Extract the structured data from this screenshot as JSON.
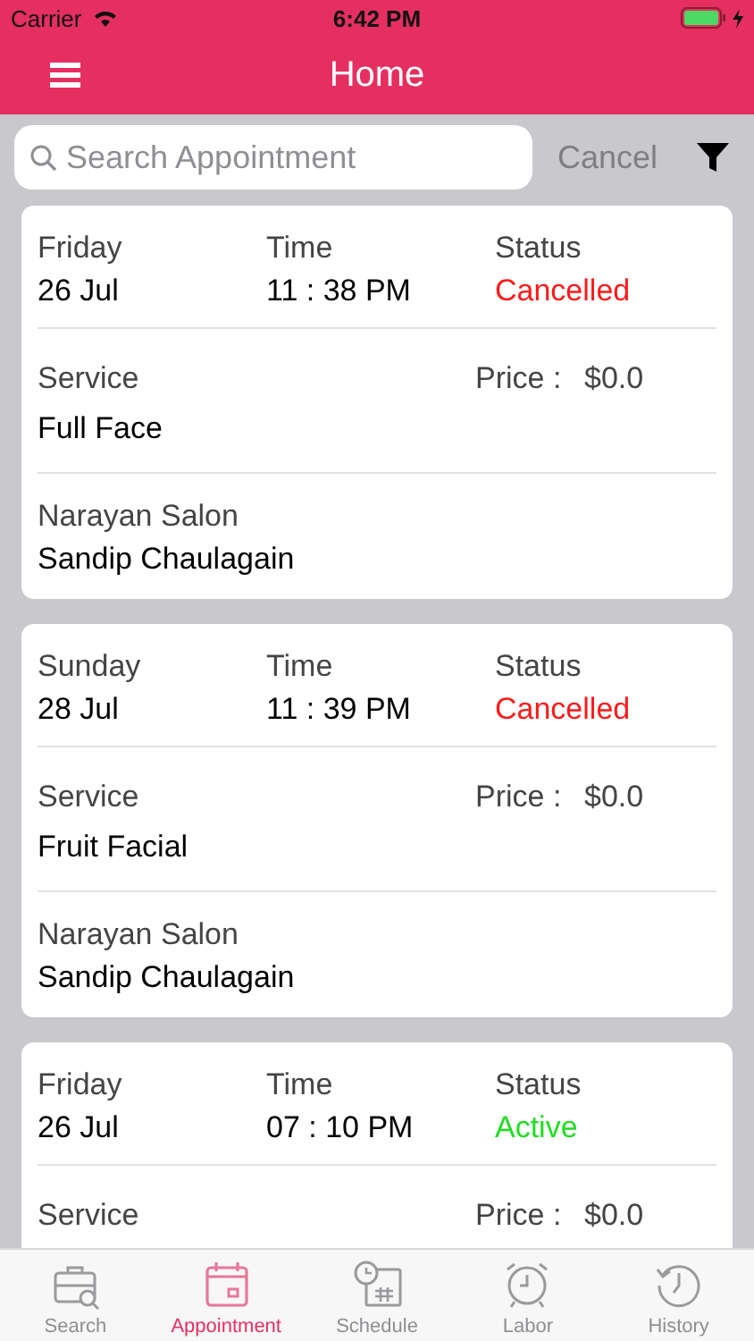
{
  "status_bar": {
    "carrier": "Carrier",
    "time": "6:42 PM"
  },
  "nav": {
    "title": "Home"
  },
  "search": {
    "placeholder": "Search Appointment",
    "cancel": "Cancel"
  },
  "appointments": [
    {
      "day": "Friday",
      "date": "26 Jul",
      "time_label": "Time",
      "time": "11 : 38 PM",
      "status_label": "Status",
      "status": {
        "text": "Cancelled",
        "color": "#ff1a1a"
      },
      "service_label": "Service",
      "price_label": "Price :",
      "price": "$0.0",
      "service": "Full Face",
      "salon": "Narayan Salon",
      "client": "Sandip Chaulagain"
    },
    {
      "day": "Sunday",
      "date": "28 Jul",
      "time_label": "Time",
      "time": "11 : 39 PM",
      "status_label": "Status",
      "status": {
        "text": "Cancelled",
        "color": "#ff1a1a"
      },
      "service_label": "Service",
      "price_label": "Price :",
      "price": "$0.0",
      "service": "Fruit Facial",
      "salon": "Narayan Salon",
      "client": "Sandip Chaulagain"
    },
    {
      "day": "Friday",
      "date": "26 Jul",
      "time_label": "Time",
      "time": "07 : 10 PM",
      "status_label": "Status",
      "status": {
        "text": "Active",
        "color": "#22dd22"
      },
      "service_label": "Service",
      "price_label": "Price :",
      "price": "$0.0"
    }
  ],
  "tabs": [
    {
      "label": "Search",
      "kind": "briefcase",
      "selected": false
    },
    {
      "label": "Appointment",
      "kind": "calendar",
      "selected": true
    },
    {
      "label": "Schedule",
      "kind": "schedule",
      "selected": false
    },
    {
      "label": "Labor",
      "kind": "alarm",
      "selected": false
    },
    {
      "label": "History",
      "kind": "history",
      "selected": false
    }
  ]
}
